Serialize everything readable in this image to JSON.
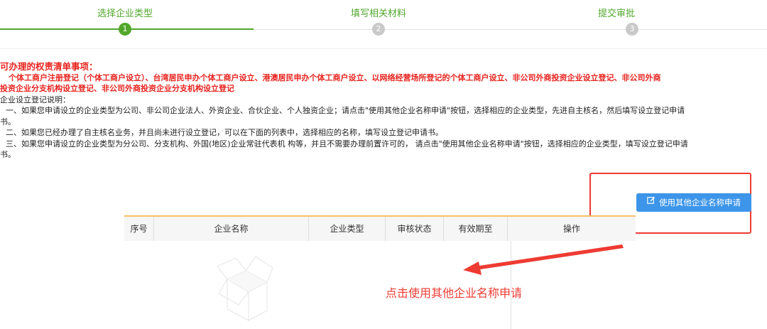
{
  "steps": [
    {
      "label": "选择企业类型",
      "number": "1",
      "state": "active"
    },
    {
      "label": "填写相关材料",
      "number": "2",
      "state": "pending"
    },
    {
      "label": "提交审批",
      "number": "3",
      "state": "pending"
    }
  ],
  "colors": {
    "active_green": "#52a72b",
    "pending_gray": "#c9c9c9",
    "alert_red": "#e8231e",
    "button_blue": "#3c95e9",
    "table_top_border": "#f5c268",
    "annotation_red": "#ee3b33"
  },
  "info": {
    "title": "可办理的权责清单事项：",
    "items_line1": "个体工商户注册登记（个体工商户设立）、台湾居民申办个体工商户设立、港澳居民申办个体工商户设立、以网络经营场所登记的个体工商户设立、非公司外商投资企业设立登记、非公司外商",
    "items_line2": "投资企业分支机构设立登记、非公司外商投资企业分支机构设立登记",
    "desc_title": "企业设立登记说明：",
    "desc1_line1": "一、如果您申请设立的企业类型为公司、非公司企业法人、外资企业、合伙企业、个人独资企业；请点击\"使用其他企业名称申请\"按钮，选择相应的企业类型，先进自主核名，然后填写设立登记申请",
    "desc1_line2": "书。",
    "desc2": "二、如果您已经办理了自主核名业务，并且尚未进行设立登记，可以在下面的列表中，选择相应的名称，填写设立登记申请书。",
    "desc3_line1": "三、如果您申请设立的企业类型为分公司、分支机构、外国(地区)企业常驻代表机 构等，并且不需要办理前置许可的， 请点击\"使用其他企业名称申请\"按钮，选择相应的企业类型，填写设立登记申请",
    "desc3_line2": "书。"
  },
  "apply_button": {
    "label": "使用其他企业名称申请",
    "icon": "edit-icon"
  },
  "table": {
    "columns": [
      "序号",
      "企业名称",
      "企业类型",
      "审核状态",
      "有效期至",
      "操作"
    ],
    "rows": []
  },
  "annotation": {
    "text": "点击使用其他企业名称申请"
  }
}
